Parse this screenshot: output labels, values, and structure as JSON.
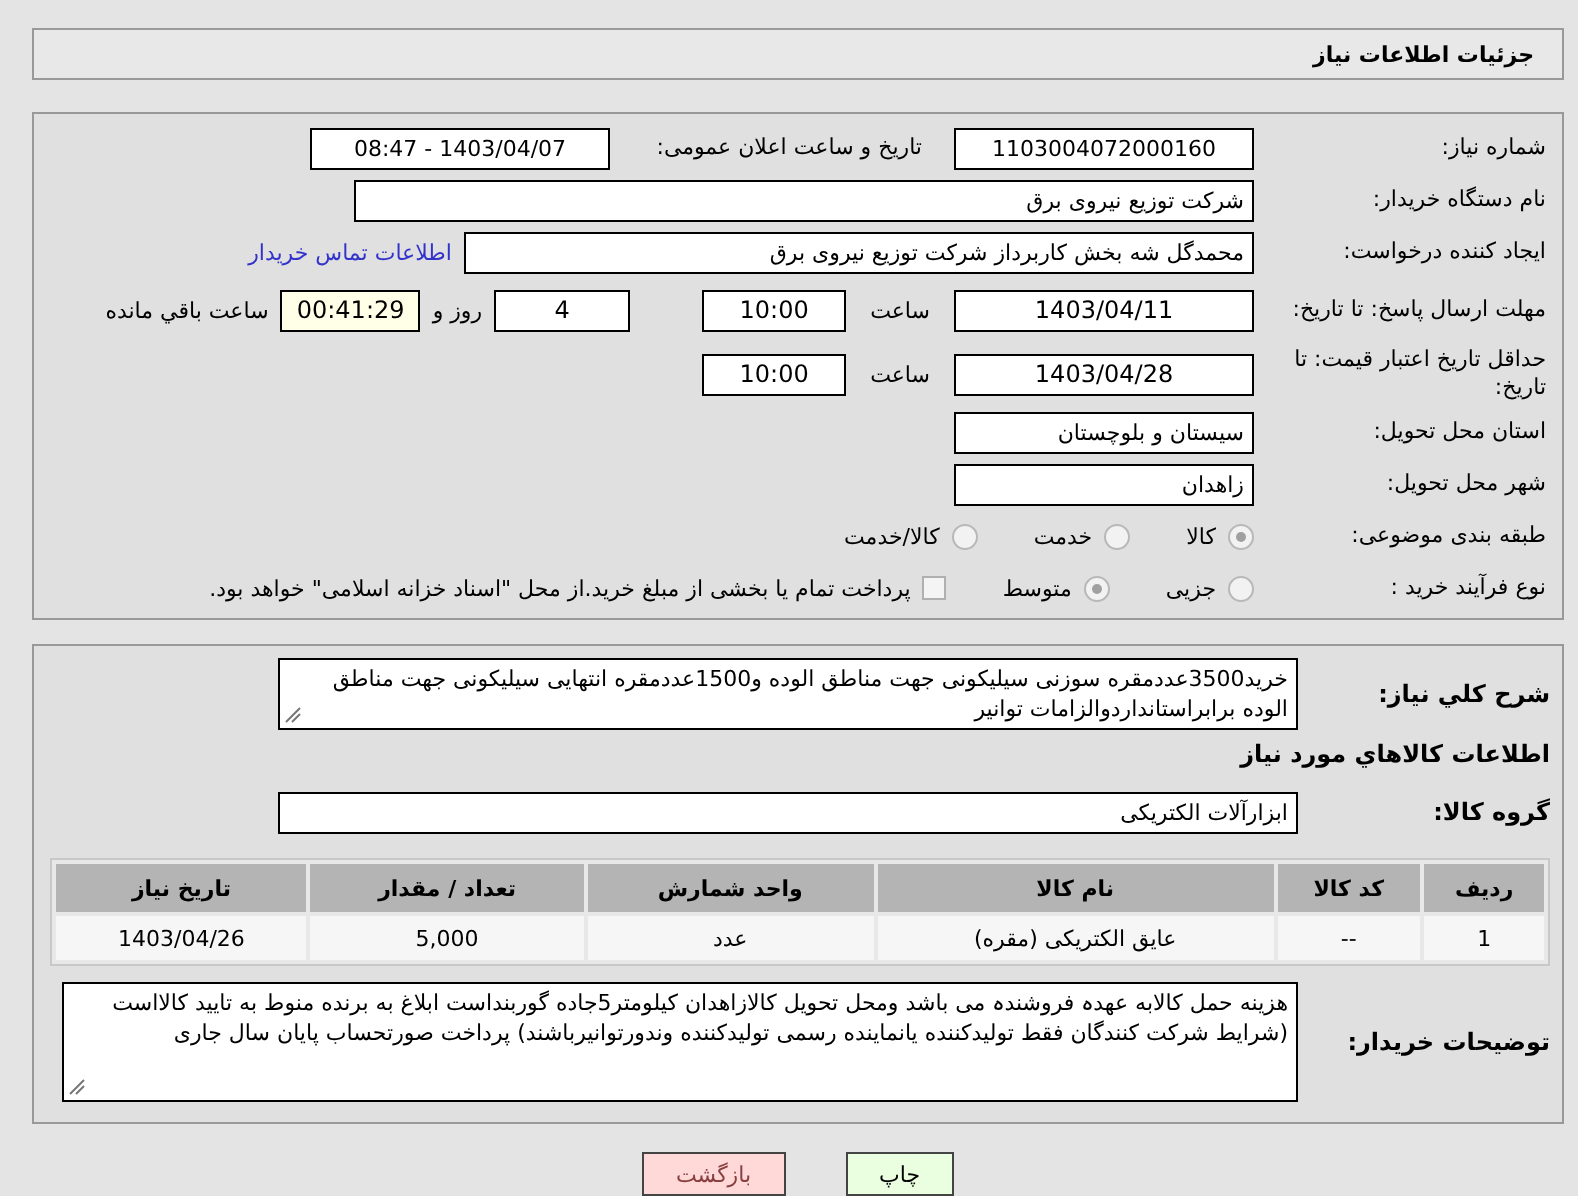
{
  "header": {
    "title": "جزئیات اطلاعات نیاز"
  },
  "form": {
    "need_number": {
      "label": "شماره نیاز:",
      "value": "1103004072000160"
    },
    "announce": {
      "label": "تاریخ و ساعت اعلان عمومی:",
      "value": "1403/04/07 - 08:47"
    },
    "buyer": {
      "label": "نام دستگاه خریدار:",
      "value": "شرکت توزیع نیروی برق"
    },
    "creator": {
      "label": "ایجاد کننده درخواست:",
      "value": "محمدگل شه بخش کاربرداز شرکت توزیع نیروی برق",
      "link": "اطلاعات تماس خریدار"
    },
    "reply_deadline": {
      "label": "مهلت ارسال پاسخ: تا تاریخ:",
      "date": "1403/04/11",
      "time_label": "ساعت",
      "time": "10:00",
      "days": "4",
      "days_label": "روز و",
      "remaining": "00:41:29",
      "remaining_label": "ساعت باقي مانده"
    },
    "price_validity": {
      "label": "حداقل تاریخ اعتبار قیمت: تا تاریخ:",
      "date": "1403/04/28",
      "time_label": "ساعت",
      "time": "10:00"
    },
    "province": {
      "label": "استان محل تحویل:",
      "value": "سیستان و بلوچستان"
    },
    "city": {
      "label": "شهر محل تحویل:",
      "value": "زاهدان"
    },
    "category": {
      "label": "طبقه بندی موضوعی:",
      "options": [
        {
          "label": "کالا",
          "selected": true
        },
        {
          "label": "خدمت",
          "selected": false
        },
        {
          "label": "کالا/خدمت",
          "selected": false
        }
      ]
    },
    "process": {
      "label": "نوع فرآیند خرید :",
      "options": [
        {
          "label": "جزیی",
          "selected": false
        },
        {
          "label": "متوسط",
          "selected": true
        }
      ],
      "treasury": {
        "checked": false,
        "label": "پرداخت تمام یا بخشی از مبلغ خرید.از محل \"اسناد خزانه اسلامی\" خواهد بود."
      }
    }
  },
  "details": {
    "description": {
      "label": "شرح کلي نياز:",
      "value": "خرید3500عددمقره سوزنی سیلیکونی جهت مناطق الوده و1500عددمقره انتهایی سیلیکونی جهت مناطق الوده برابراستانداردوالزامات توانیر"
    },
    "goods_title": "اطلاعات کالاهاي مورد نياز",
    "group": {
      "label": "گروه کالا:",
      "value": "ابزارآلات الکتریکی"
    },
    "table": {
      "columns": [
        "ردیف",
        "کد کالا",
        "نام کالا",
        "واحد شمارش",
        "تعداد / مقدار",
        "تاریخ نیاز"
      ],
      "rows": [
        [
          "1",
          "--",
          "عایق الکتریکی (مقره)",
          "عدد",
          "5,000",
          "1403/04/26"
        ]
      ]
    },
    "notes": {
      "label": "توضیحات خریدار:",
      "value": "هزینه حمل کالابه عهدہ فروشندہ می باشد ومحل تحویل کالازاهدان کیلومتر5جاده گوربنداست ابلاغ به برنده منوط به تایید کالااست (شرایط شرکت کنندگان فقط تولیدکننده یانماینده رسمی تولیدکننده وندورتوانیرباشند) پرداخت صورتحساب پایان سال جاری"
    }
  },
  "buttons": [
    {
      "label": "چاپ",
      "kind": "print"
    },
    {
      "label": "بازگشت",
      "kind": "back"
    }
  ]
}
